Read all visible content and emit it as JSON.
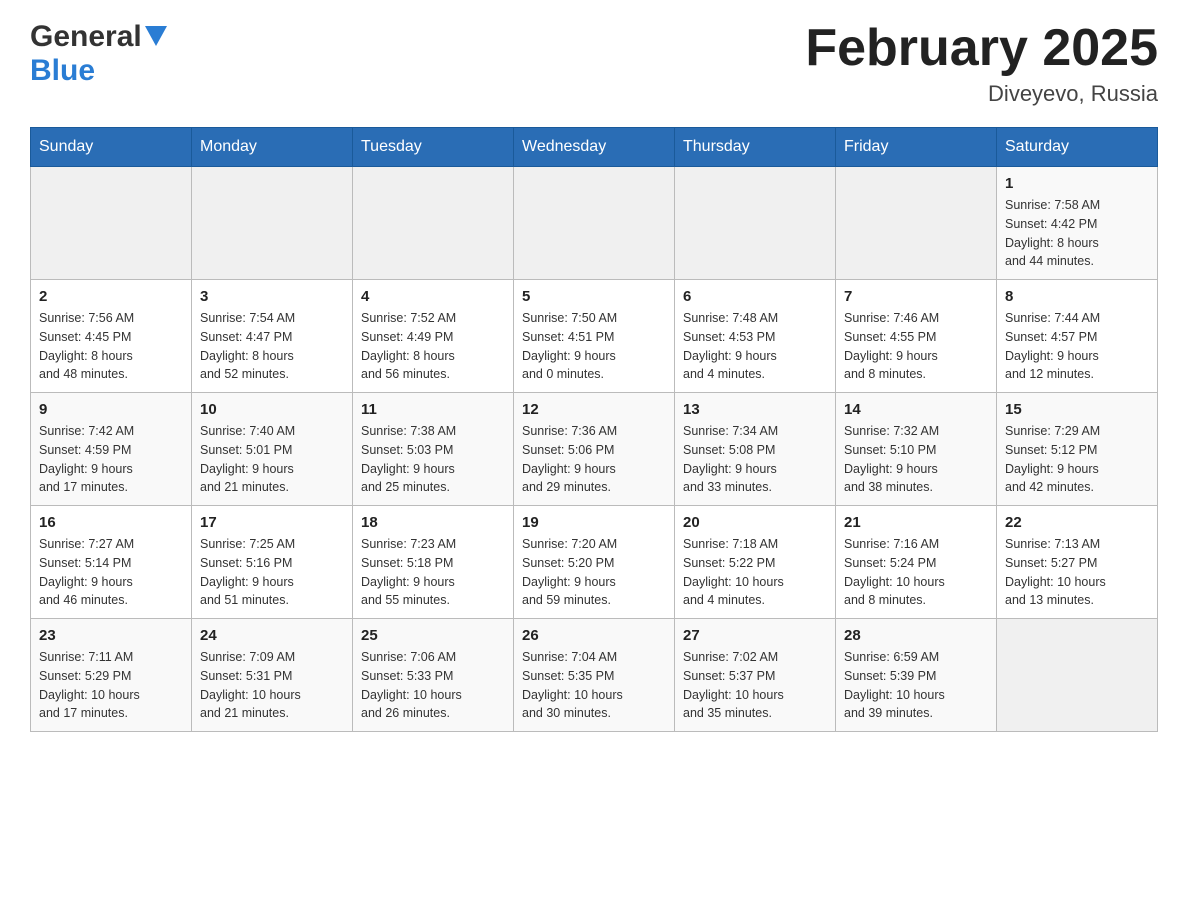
{
  "header": {
    "logo_general": "General",
    "logo_blue": "Blue",
    "month_title": "February 2025",
    "location": "Diveyevo, Russia"
  },
  "calendar": {
    "days_of_week": [
      "Sunday",
      "Monday",
      "Tuesday",
      "Wednesday",
      "Thursday",
      "Friday",
      "Saturday"
    ],
    "weeks": [
      [
        {
          "day": "",
          "info": ""
        },
        {
          "day": "",
          "info": ""
        },
        {
          "day": "",
          "info": ""
        },
        {
          "day": "",
          "info": ""
        },
        {
          "day": "",
          "info": ""
        },
        {
          "day": "",
          "info": ""
        },
        {
          "day": "1",
          "info": "Sunrise: 7:58 AM\nSunset: 4:42 PM\nDaylight: 8 hours\nand 44 minutes."
        }
      ],
      [
        {
          "day": "2",
          "info": "Sunrise: 7:56 AM\nSunset: 4:45 PM\nDaylight: 8 hours\nand 48 minutes."
        },
        {
          "day": "3",
          "info": "Sunrise: 7:54 AM\nSunset: 4:47 PM\nDaylight: 8 hours\nand 52 minutes."
        },
        {
          "day": "4",
          "info": "Sunrise: 7:52 AM\nSunset: 4:49 PM\nDaylight: 8 hours\nand 56 minutes."
        },
        {
          "day": "5",
          "info": "Sunrise: 7:50 AM\nSunset: 4:51 PM\nDaylight: 9 hours\nand 0 minutes."
        },
        {
          "day": "6",
          "info": "Sunrise: 7:48 AM\nSunset: 4:53 PM\nDaylight: 9 hours\nand 4 minutes."
        },
        {
          "day": "7",
          "info": "Sunrise: 7:46 AM\nSunset: 4:55 PM\nDaylight: 9 hours\nand 8 minutes."
        },
        {
          "day": "8",
          "info": "Sunrise: 7:44 AM\nSunset: 4:57 PM\nDaylight: 9 hours\nand 12 minutes."
        }
      ],
      [
        {
          "day": "9",
          "info": "Sunrise: 7:42 AM\nSunset: 4:59 PM\nDaylight: 9 hours\nand 17 minutes."
        },
        {
          "day": "10",
          "info": "Sunrise: 7:40 AM\nSunset: 5:01 PM\nDaylight: 9 hours\nand 21 minutes."
        },
        {
          "day": "11",
          "info": "Sunrise: 7:38 AM\nSunset: 5:03 PM\nDaylight: 9 hours\nand 25 minutes."
        },
        {
          "day": "12",
          "info": "Sunrise: 7:36 AM\nSunset: 5:06 PM\nDaylight: 9 hours\nand 29 minutes."
        },
        {
          "day": "13",
          "info": "Sunrise: 7:34 AM\nSunset: 5:08 PM\nDaylight: 9 hours\nand 33 minutes."
        },
        {
          "day": "14",
          "info": "Sunrise: 7:32 AM\nSunset: 5:10 PM\nDaylight: 9 hours\nand 38 minutes."
        },
        {
          "day": "15",
          "info": "Sunrise: 7:29 AM\nSunset: 5:12 PM\nDaylight: 9 hours\nand 42 minutes."
        }
      ],
      [
        {
          "day": "16",
          "info": "Sunrise: 7:27 AM\nSunset: 5:14 PM\nDaylight: 9 hours\nand 46 minutes."
        },
        {
          "day": "17",
          "info": "Sunrise: 7:25 AM\nSunset: 5:16 PM\nDaylight: 9 hours\nand 51 minutes."
        },
        {
          "day": "18",
          "info": "Sunrise: 7:23 AM\nSunset: 5:18 PM\nDaylight: 9 hours\nand 55 minutes."
        },
        {
          "day": "19",
          "info": "Sunrise: 7:20 AM\nSunset: 5:20 PM\nDaylight: 9 hours\nand 59 minutes."
        },
        {
          "day": "20",
          "info": "Sunrise: 7:18 AM\nSunset: 5:22 PM\nDaylight: 10 hours\nand 4 minutes."
        },
        {
          "day": "21",
          "info": "Sunrise: 7:16 AM\nSunset: 5:24 PM\nDaylight: 10 hours\nand 8 minutes."
        },
        {
          "day": "22",
          "info": "Sunrise: 7:13 AM\nSunset: 5:27 PM\nDaylight: 10 hours\nand 13 minutes."
        }
      ],
      [
        {
          "day": "23",
          "info": "Sunrise: 7:11 AM\nSunset: 5:29 PM\nDaylight: 10 hours\nand 17 minutes."
        },
        {
          "day": "24",
          "info": "Sunrise: 7:09 AM\nSunset: 5:31 PM\nDaylight: 10 hours\nand 21 minutes."
        },
        {
          "day": "25",
          "info": "Sunrise: 7:06 AM\nSunset: 5:33 PM\nDaylight: 10 hours\nand 26 minutes."
        },
        {
          "day": "26",
          "info": "Sunrise: 7:04 AM\nSunset: 5:35 PM\nDaylight: 10 hours\nand 30 minutes."
        },
        {
          "day": "27",
          "info": "Sunrise: 7:02 AM\nSunset: 5:37 PM\nDaylight: 10 hours\nand 35 minutes."
        },
        {
          "day": "28",
          "info": "Sunrise: 6:59 AM\nSunset: 5:39 PM\nDaylight: 10 hours\nand 39 minutes."
        },
        {
          "day": "",
          "info": ""
        }
      ]
    ]
  }
}
